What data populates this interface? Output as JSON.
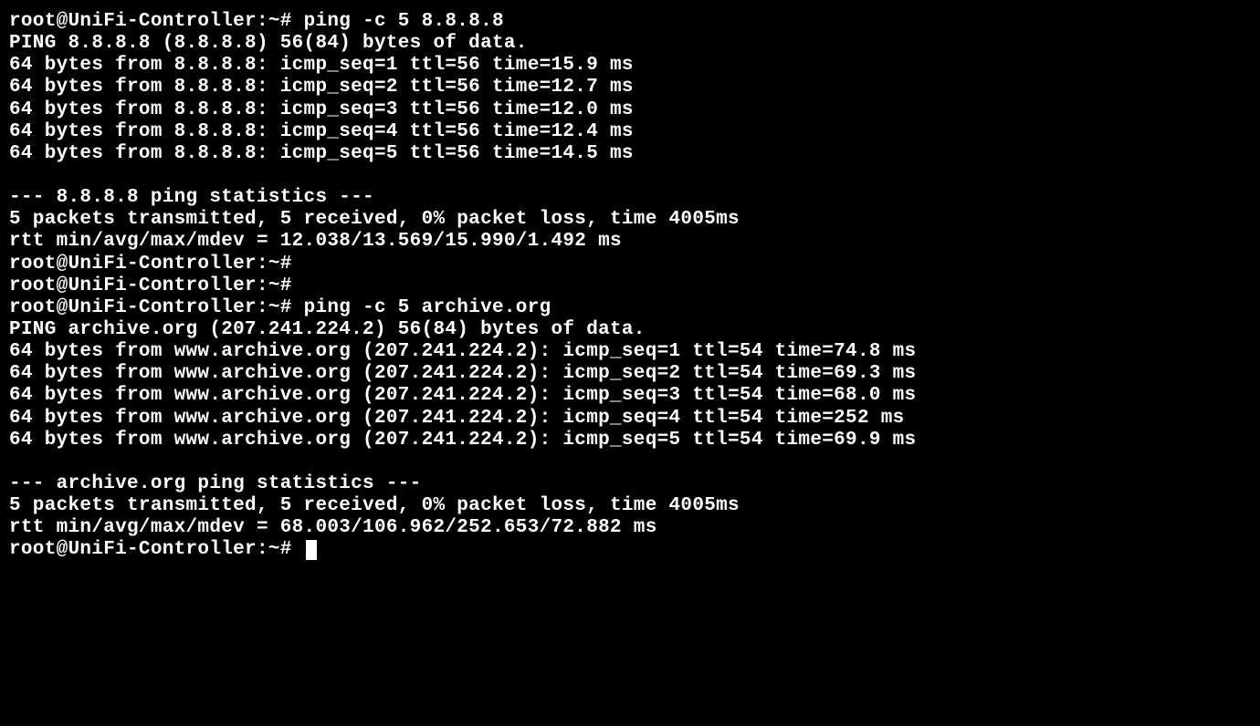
{
  "prompt": "root@UniFi-Controller:~# ",
  "cmd1": "ping -c 5 8.8.8.8",
  "ping1_header": "PING 8.8.8.8 (8.8.8.8) 56(84) bytes of data.",
  "ping1_line1": "64 bytes from 8.8.8.8: icmp_seq=1 ttl=56 time=15.9 ms",
  "ping1_line2": "64 bytes from 8.8.8.8: icmp_seq=2 ttl=56 time=12.7 ms",
  "ping1_line3": "64 bytes from 8.8.8.8: icmp_seq=3 ttl=56 time=12.0 ms",
  "ping1_line4": "64 bytes from 8.8.8.8: icmp_seq=4 ttl=56 time=12.4 ms",
  "ping1_line5": "64 bytes from 8.8.8.8: icmp_seq=5 ttl=56 time=14.5 ms",
  "ping1_stats_header": "--- 8.8.8.8 ping statistics ---",
  "ping1_stats_summary": "5 packets transmitted, 5 received, 0% packet loss, time 4005ms",
  "ping1_stats_rtt": "rtt min/avg/max/mdev = 12.038/13.569/15.990/1.492 ms",
  "cmd2": "ping -c 5 archive.org",
  "ping2_header": "PING archive.org (207.241.224.2) 56(84) bytes of data.",
  "ping2_line1": "64 bytes from www.archive.org (207.241.224.2): icmp_seq=1 ttl=54 time=74.8 ms",
  "ping2_line2": "64 bytes from www.archive.org (207.241.224.2): icmp_seq=2 ttl=54 time=69.3 ms",
  "ping2_line3": "64 bytes from www.archive.org (207.241.224.2): icmp_seq=3 ttl=54 time=68.0 ms",
  "ping2_line4": "64 bytes from www.archive.org (207.241.224.2): icmp_seq=4 ttl=54 time=252 ms",
  "ping2_line5": "64 bytes from www.archive.org (207.241.224.2): icmp_seq=5 ttl=54 time=69.9 ms",
  "ping2_stats_header": "--- archive.org ping statistics ---",
  "ping2_stats_summary": "5 packets transmitted, 5 received, 0% packet loss, time 4005ms",
  "ping2_stats_rtt": "rtt min/avg/max/mdev = 68.003/106.962/252.653/72.882 ms"
}
